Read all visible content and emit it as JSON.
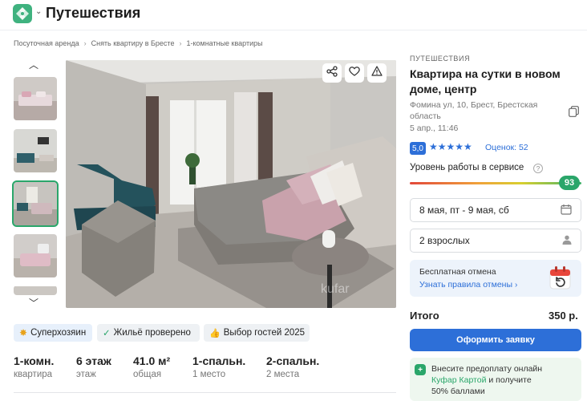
{
  "header": {
    "title": "Путешествия"
  },
  "breadcrumbs": [
    "Посуточная аренда",
    "Снять квартиру в Бресте",
    "1-комнатные квартиры"
  ],
  "gallery": {
    "watermark": "kufar"
  },
  "badges": {
    "superhost": "Суперхозяин",
    "verified": "Жильё проверено",
    "guests_choice": "Выбор гостей 2025"
  },
  "facts": [
    {
      "value": "1-комн.",
      "label": "квартира"
    },
    {
      "value": "6 этаж",
      "label": "этаж"
    },
    {
      "value": "41.0 м²",
      "label": "общая"
    },
    {
      "value": "1-спальн.",
      "label": "1 место"
    },
    {
      "value": "2-спальн.",
      "label": "2 места"
    }
  ],
  "listing": {
    "category": "ПУТЕШЕСТВИЯ",
    "title": "Квартира на сутки в новом доме, центр",
    "address": "Фомина ул, 10, Брест, Брестская область",
    "date": "5 апр., 11:46",
    "rating": "5,0",
    "stars": "★★★★★",
    "reviews": "Оценок: 52",
    "service_label": "Уровень работы в сервисе",
    "service_score": "93",
    "service_fraction": 0.93
  },
  "booking": {
    "dates": "8 мая, пт - 9 мая, сб",
    "guests": "2 взрослых",
    "cancel_title": "Бесплатная отмена",
    "cancel_link": "Узнать правила отмены",
    "total_label": "Итого",
    "total_value": "350 р.",
    "submit_label": "Оформить заявку"
  },
  "promo": {
    "line1": "Внесите предоплату онлайн",
    "link": "Куфар Картой",
    "line2": " и получите",
    "line3": "50% баллами"
  },
  "colors": {
    "brand": "#3fb27f",
    "accent": "#2d6fd8",
    "score": "#2aa66a"
  }
}
